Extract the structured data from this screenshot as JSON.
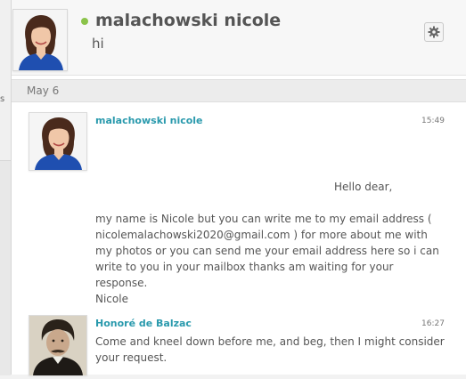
{
  "left_edge_text": "s",
  "header": {
    "contact_name": "malachowski nicole",
    "last_message": "hi",
    "status_color": "#8bc34a",
    "settings_icon": "gear-icon"
  },
  "date_divider": "May 6",
  "messages": [
    {
      "sender": "malachowski nicole",
      "time": "15:49",
      "greeting": "Hello dear,",
      "paragraph": "my name is Nicole but you can write me to my email address ( nicolemalachowski2020@gmail.com ) for more about me with my photos or you can send me your email address here so i can write to you in your mailbox thanks am waiting for your response.",
      "signature": "Nicole"
    },
    {
      "sender": "Honoré de Balzac",
      "time": "16:27",
      "text": "Come and kneel down before me, and beg, then I might consider your request."
    }
  ],
  "colors": {
    "sender_link": "#2a9aad",
    "text": "#555555"
  }
}
